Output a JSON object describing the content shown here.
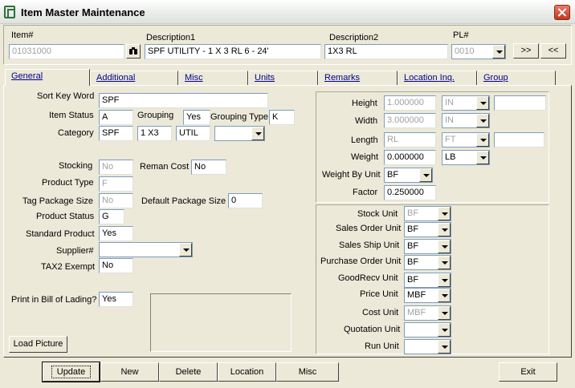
{
  "window": {
    "title": "Item Master Maintenance"
  },
  "header": {
    "item_label": "Item#",
    "item_value": "01031000",
    "desc1_label": "Description1",
    "desc1_value": "SPF UTILITY - 1 X 3 RL 6 - 24'",
    "desc2_label": "Description2",
    "desc2_value": "1X3 RL",
    "pl_label": "PL#",
    "pl_value": "0010",
    "next_label": ">>",
    "prev_label": "<<"
  },
  "tabs": [
    "General",
    "Additional",
    "Misc",
    "Units",
    "Remarks",
    "Location Inq.",
    "Group"
  ],
  "general": {
    "sort_key_label": "Sort Key Word",
    "sort_key_value": "SPF",
    "item_status_label": "Item Status",
    "item_status_value": "A",
    "grouping_label": "Grouping",
    "grouping_value": "Yes",
    "grouping_type_label": "Grouping Type",
    "grouping_type_value": "K",
    "category_label": "Category",
    "category_1": "SPF",
    "category_2": "1 X3",
    "category_3": "UTIL",
    "category_4": "",
    "stocking_label": "Stocking",
    "stocking_value": "No",
    "reman_cost_label": "Reman Cost",
    "reman_cost_value": "No",
    "product_type_label": "Product Type",
    "product_type_value": "F",
    "tag_package_label": "Tag Package Size",
    "tag_package_value": "No",
    "default_package_label": "Default Package Size",
    "default_package_value": "0",
    "product_status_label": "Product Status",
    "product_status_value": "G",
    "standard_product_label": "Standard Product",
    "standard_product_value": "Yes",
    "supplier_label": "Supplier#",
    "supplier_value": "",
    "tax2_label": "TAX2 Exempt",
    "tax2_value": "No",
    "print_bol_label": "Print in Bill of Lading?",
    "print_bol_value": "Yes",
    "load_picture_label": "Load Picture"
  },
  "dimensions": {
    "height_label": "Height",
    "height_value": "1.000000",
    "height_unit": "IN",
    "width_label": "Width",
    "width_value": "3.000000",
    "width_unit": "IN",
    "length_label": "Length",
    "length_value": "RL",
    "length_unit": "FT",
    "weight_label": "Weight",
    "weight_value": "0.000000",
    "weight_unit": "LB",
    "weight_by_unit_label": "Weight By Unit",
    "weight_by_unit_value": "BF",
    "factor_label": "Factor",
    "factor_value": "0.250000"
  },
  "units": {
    "stock_label": "Stock Unit",
    "stock_value": "BF",
    "sales_order_label": "Sales Order Unit",
    "sales_order_value": "BF",
    "sales_ship_label": "Sales Ship Unit",
    "sales_ship_value": "BF",
    "purchase_order_label": "Purchase Order Unit",
    "purchase_order_value": "BF",
    "goodrecv_label": "GoodRecv Unit",
    "goodrecv_value": "BF",
    "price_label": "Price Unit",
    "price_value": "MBF",
    "cost_label": "Cost Unit",
    "cost_value": "MBF",
    "quotation_label": "Quotation Unit",
    "quotation_value": "",
    "run_label": "Run Unit",
    "run_value": ""
  },
  "footer": {
    "update": "Update",
    "new": "New",
    "delete": "Delete",
    "location": "Location",
    "misc": "Misc",
    "exit": "Exit"
  }
}
